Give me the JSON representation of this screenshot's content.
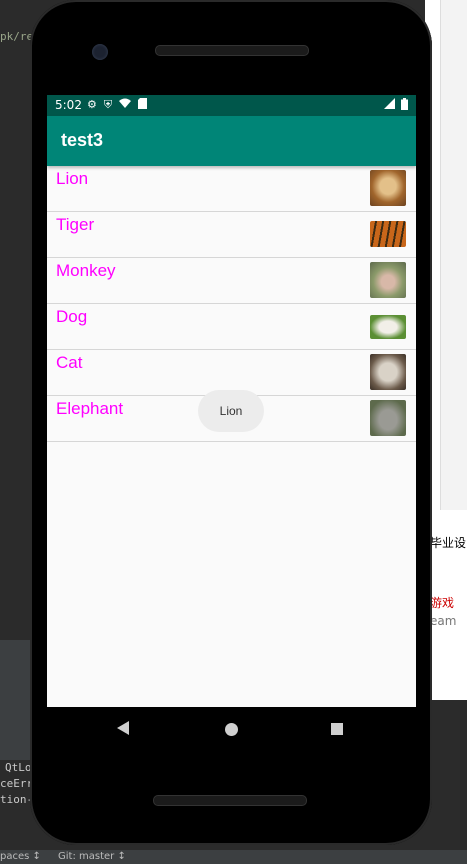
{
  "ide": {
    "code_fragment": "pk/re",
    "bottom_lines": [
      "QtLo",
      "ceErr",
      "tion-lo"
    ],
    "statusbar_left": "paces ↕",
    "statusbar_git": "Git: master ↕"
  },
  "right_panel": {
    "lines": [
      {
        "text": "毕业设",
        "color": "#000000"
      },
      {
        "text": "游戏",
        "color": "#cc0000"
      },
      {
        "text": "eam",
        "color": "#777777"
      }
    ]
  },
  "phone": {
    "status_bar": {
      "time": "5:02",
      "icons": [
        "gear-icon",
        "shield-icon",
        "wifi-icon",
        "sd-card-icon"
      ],
      "right_icons": [
        "signal-icon",
        "battery-icon"
      ]
    },
    "app_bar": {
      "title": "test3"
    },
    "animals": [
      {
        "label": "Lion",
        "thumb_icon": "lion-thumbnail",
        "colors": [
          "#a0652c",
          "#e3c089"
        ]
      },
      {
        "label": "Tiger",
        "thumb_icon": "tiger-thumbnail",
        "colors": [
          "#c8661a",
          "#3b2a12"
        ]
      },
      {
        "label": "Monkey",
        "thumb_icon": "monkey-thumbnail",
        "colors": [
          "#8b9a6a",
          "#d8b8a8"
        ]
      },
      {
        "label": "Dog",
        "thumb_icon": "dog-thumbnail",
        "colors": [
          "#5b8f34",
          "#f2efe8"
        ]
      },
      {
        "label": "Cat",
        "thumb_icon": "cat-thumbnail",
        "colors": [
          "#6b5a4a",
          "#d9d2c7"
        ]
      },
      {
        "label": "Elephant",
        "thumb_icon": "elephant-thumbnail",
        "colors": [
          "#5d6a4c",
          "#9a9a94"
        ]
      }
    ],
    "toast": "Lion",
    "nav": [
      "back-icon",
      "home-icon",
      "recent-apps-icon"
    ]
  },
  "colors": {
    "status_bar": "#00574b",
    "app_bar": "#008577",
    "item_text": "#ff00ff"
  }
}
